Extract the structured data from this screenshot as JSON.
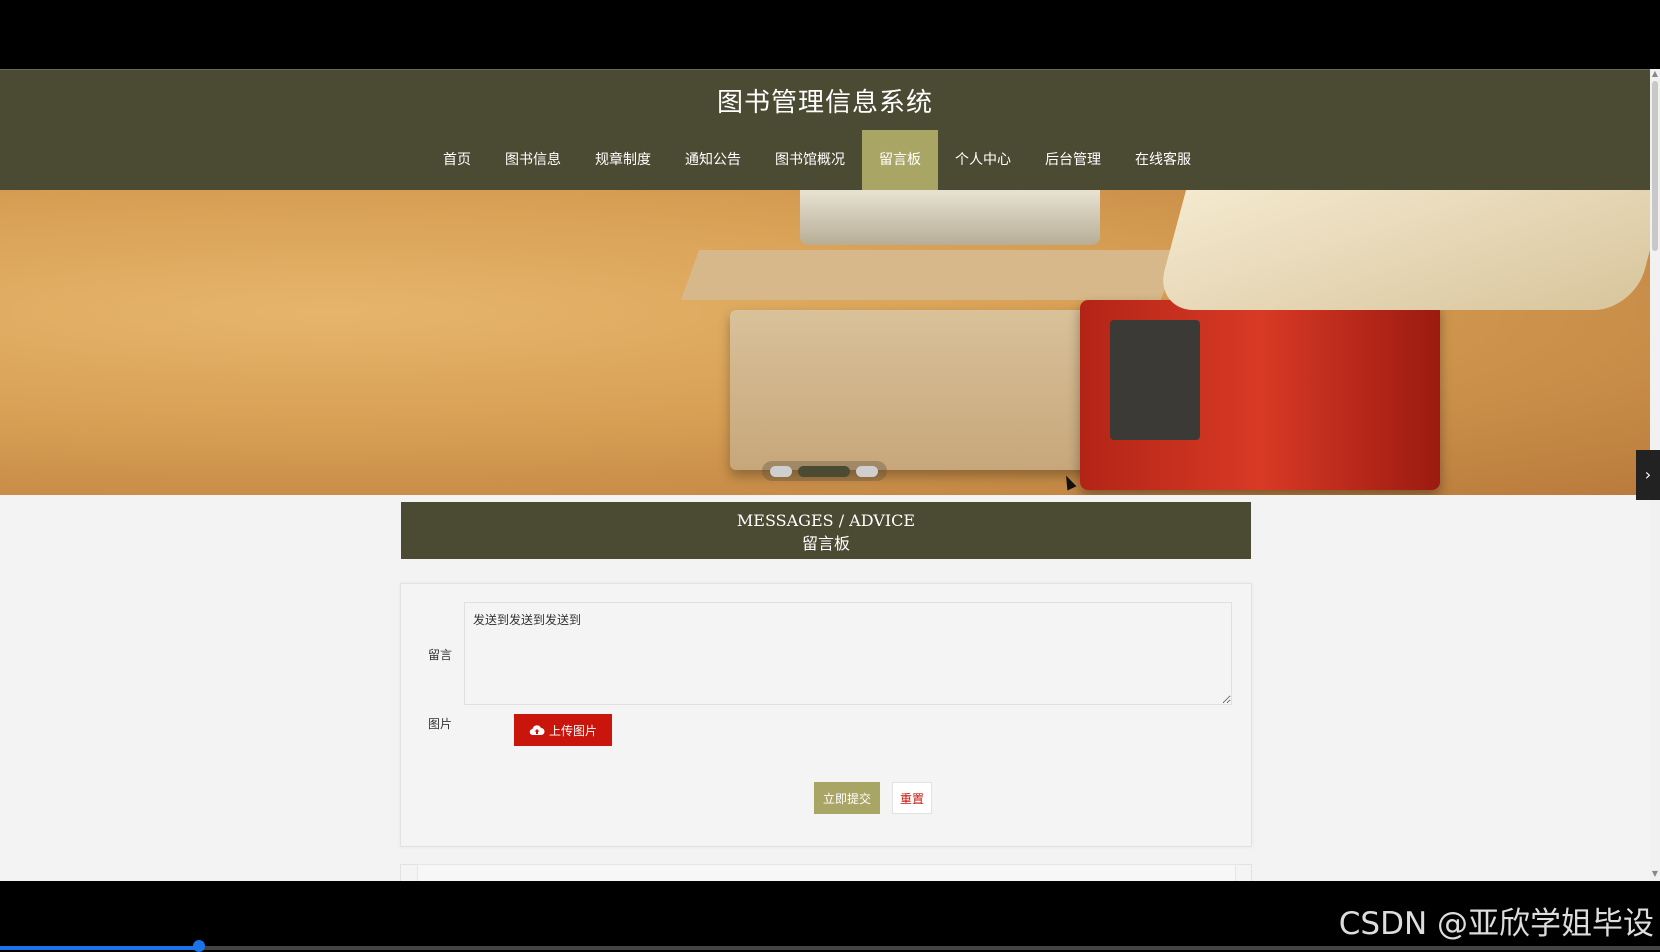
{
  "header": {
    "site_title": "图书管理信息系统"
  },
  "nav": {
    "items": [
      {
        "label": "首页"
      },
      {
        "label": "图书信息"
      },
      {
        "label": "规章制度"
      },
      {
        "label": "通知公告"
      },
      {
        "label": "图书馆概况"
      },
      {
        "label": "留言板",
        "active": true
      },
      {
        "label": "个人中心"
      },
      {
        "label": "后台管理"
      },
      {
        "label": "在线客服"
      }
    ]
  },
  "banner": {
    "slide_count": 3,
    "active_slide": 2,
    "next_icon": "chevron-right-icon"
  },
  "section": {
    "title_en": "MESSAGES / ADVICE",
    "title_cn": "留言板"
  },
  "form": {
    "message_label": "留言",
    "message_value": "发送到发送到发送到",
    "image_label": "图片",
    "upload_label": "上传图片",
    "upload_icon": "cloud-upload-icon",
    "submit_label": "立即提交",
    "reset_label": "重置"
  },
  "colors": {
    "nav_bg": "#4b4a33",
    "nav_active": "#a8a565",
    "upload_red": "#c9150c"
  },
  "watermark": "CSDN @亚欣学姐毕设"
}
